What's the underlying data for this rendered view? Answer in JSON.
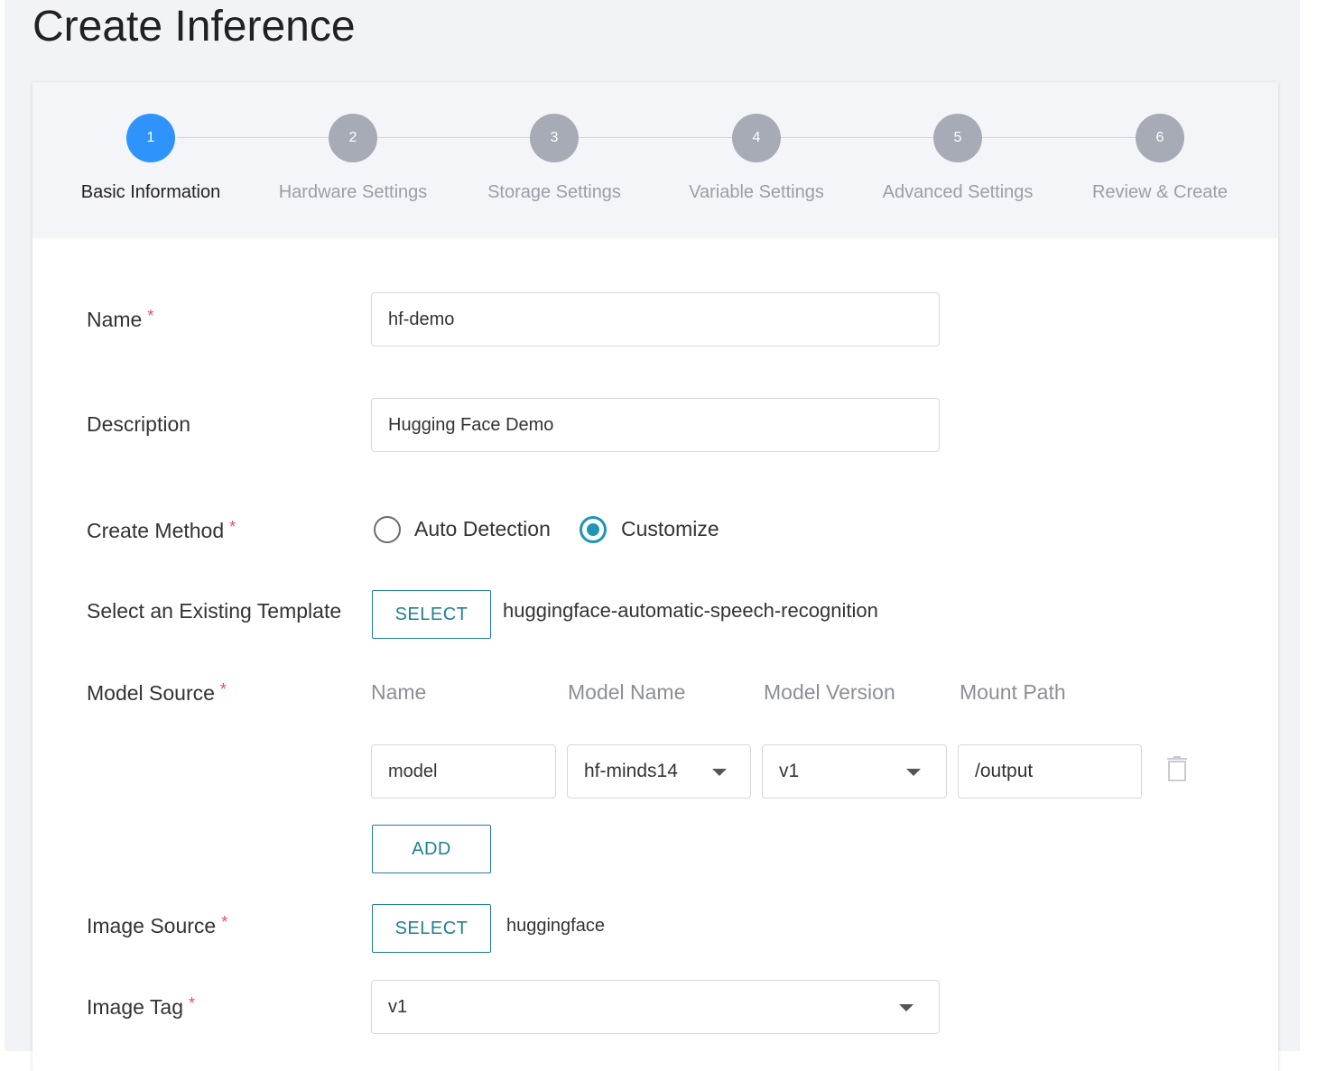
{
  "page": {
    "title": "Create Inference"
  },
  "stepper": {
    "steps": [
      {
        "number": "1",
        "label": "Basic Information",
        "active": true
      },
      {
        "number": "2",
        "label": "Hardware Settings",
        "active": false
      },
      {
        "number": "3",
        "label": "Storage Settings",
        "active": false
      },
      {
        "number": "4",
        "label": "Variable Settings",
        "active": false
      },
      {
        "number": "5",
        "label": "Advanced Settings",
        "active": false
      },
      {
        "number": "6",
        "label": "Review & Create",
        "active": false
      }
    ]
  },
  "form": {
    "required_mark": "*",
    "name": {
      "label": "Name",
      "value": "hf-demo"
    },
    "description": {
      "label": "Description",
      "value": "Hugging Face Demo"
    },
    "create_method": {
      "label": "Create Method",
      "options": [
        {
          "label": "Auto Detection",
          "checked": false
        },
        {
          "label": "Customize",
          "checked": true
        }
      ]
    },
    "template": {
      "label": "Select an Existing Template",
      "button_label": "SELECT",
      "selected": "huggingface-automatic-speech-recognition"
    },
    "model_source": {
      "label": "Model Source",
      "columns": [
        "Name",
        "Model Name",
        "Model Version",
        "Mount Path"
      ],
      "rows": [
        {
          "name": "model",
          "model_name": "hf-minds14",
          "model_version": "v1",
          "mount_path": "/output"
        }
      ],
      "add_label": "ADD"
    },
    "image_source": {
      "label": "Image Source",
      "button_label": "SELECT",
      "selected": "huggingface"
    },
    "image_tag": {
      "label": "Image Tag",
      "value": "v1"
    }
  },
  "colors": {
    "active_step": "#2e93fb",
    "inactive_step": "#a7abb6",
    "accent": "#1f7f93",
    "required": "#e94b6b",
    "radio_checked": "#1f95b6"
  },
  "icons": {
    "delete_row": "trash-icon",
    "dropdown": "caret-down-icon"
  }
}
